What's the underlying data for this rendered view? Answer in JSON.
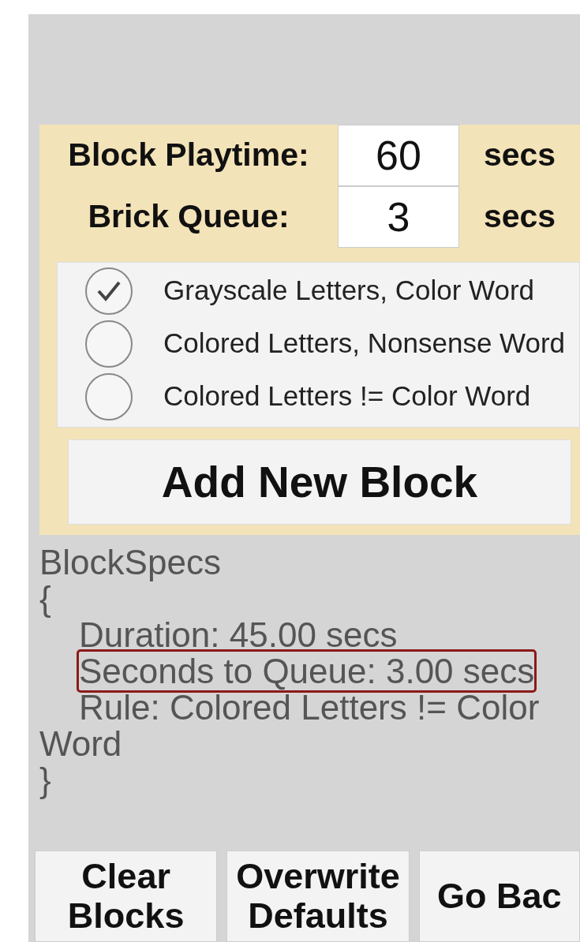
{
  "settings": [
    {
      "label": "Block Playtime:",
      "value": "60",
      "unit": "secs"
    },
    {
      "label": "Brick Queue:",
      "value": "3",
      "unit": "secs"
    }
  ],
  "rules": [
    {
      "label": "Grayscale Letters, Color Word",
      "selected": true
    },
    {
      "label": "Colored Letters, Nonsense Word",
      "selected": false
    },
    {
      "label": "Colored Letters != Color Word",
      "selected": false
    }
  ],
  "add_button": "Add New Block",
  "specs": [
    {
      "text": "BlockSpecs",
      "indented": false,
      "highlighted": false
    },
    {
      "text": "{",
      "indented": false,
      "highlighted": false
    },
    {
      "text": "Duration: 45.00 secs",
      "indented": true,
      "highlighted": false
    },
    {
      "text": "Seconds to Queue: 3.00 secs",
      "indented": true,
      "highlighted": true
    },
    {
      "text": "Rule: Colored Letters != Color Word",
      "indented": true,
      "highlighted": false
    },
    {
      "text": "}",
      "indented": false,
      "highlighted": false
    }
  ],
  "buttons": [
    [
      "Clear",
      "Blocks"
    ],
    [
      "Overwrite",
      "Defaults"
    ],
    [
      "Go Bac"
    ]
  ]
}
